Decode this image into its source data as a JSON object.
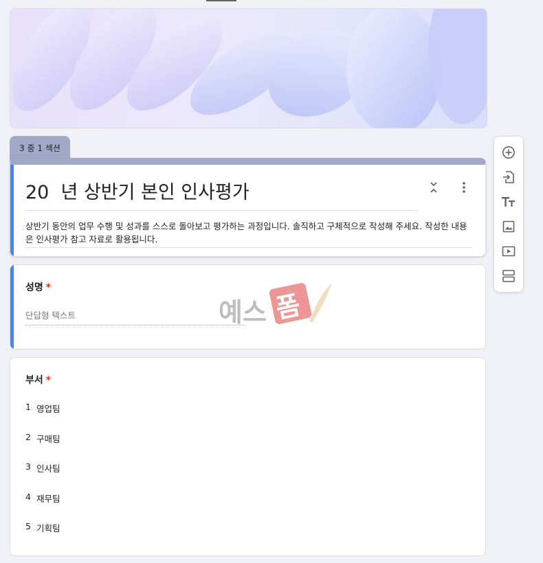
{
  "section_tab": {
    "label": "3 중 1 섹션"
  },
  "form": {
    "title": "20  년 상반기 본인 인사평가",
    "description": "상반기 동안의 업무 수행 및 성과를 스스로 돌아보고 평가하는 과정입니다. 솔직하고 구체적으로 작성해 주세요. 작성한 내용은 인사평가 참고 자료로 활용됩니다."
  },
  "questions": {
    "name": {
      "title": "성명",
      "required_mark": "*",
      "placeholder": "단답형 텍스트"
    },
    "dept": {
      "title": "부서",
      "required_mark": "*",
      "options": [
        {
          "num": "1",
          "label": "영업팀"
        },
        {
          "num": "2",
          "label": "구매팀"
        },
        {
          "num": "3",
          "label": "인사팀"
        },
        {
          "num": "4",
          "label": "재무팀"
        },
        {
          "num": "5",
          "label": "기획팀"
        }
      ]
    }
  },
  "toolbar": {
    "icons": [
      "add-question-icon",
      "import-questions-icon",
      "add-title-icon",
      "add-image-icon",
      "add-video-icon",
      "add-section-icon"
    ]
  },
  "watermark": {
    "text_left": "예스",
    "text_stamp": "폼"
  },
  "colors": {
    "accent_blue": "#4285f4",
    "header_gray_purple": "#a2a9c8",
    "required_red": "#d93025",
    "background": "#f0f1f7"
  }
}
